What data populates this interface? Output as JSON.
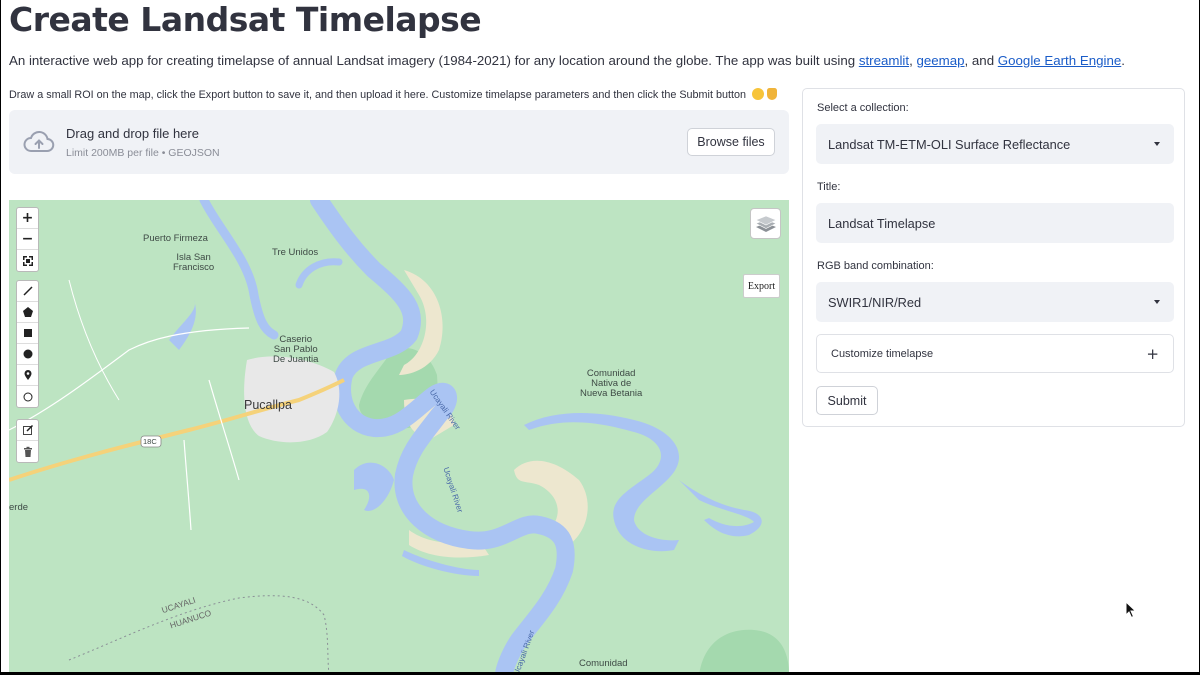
{
  "header": {
    "title": "Create Landsat Timelapse",
    "intro_prefix": "An interactive web app for creating timelapse of annual Landsat imagery (1984-2021) for any location around the globe. The app was built using ",
    "link_streamlit": "streamlit",
    "sep1": ", ",
    "link_geemap": "geemap",
    "sep2": ", and ",
    "link_gee": "Google Earth Engine",
    "intro_suffix": "."
  },
  "instructions": "Draw a small ROI on the map, click the Export button to save it, and then upload it here. Customize timelapse parameters and then click the Submit button",
  "uploader": {
    "title": "Drag and drop file here",
    "limit": "Limit 200MB per file • GEOJSON",
    "browse_label": "Browse files"
  },
  "map": {
    "export_label": "Export",
    "labels": {
      "puerto_firmeza": "Puerto Firmeza",
      "isla_san_francisco": "Isla San\nFrancisco",
      "tre_unidos": "Tre Unidos",
      "caserio": "Caserio\nSan Pablo\nDe Juantia",
      "pucallpa": "Pucallpa",
      "comunidad_nativa": "Comunidad\nNativa de\nNueva Betania",
      "ucayali_river_1": "Ucayali River",
      "ucayali_river_2": "Ucayali River",
      "ucayali_river_3": "Ucayali River",
      "road_18c": "18C",
      "verde": "erde",
      "ucayali_region": "UCAYALI",
      "huanuco_region": "HUANUCO",
      "comunidad_bottom": "Comunidad"
    },
    "colors": {
      "land": "#bde4c2",
      "water": "#aac4f3",
      "sand": "#ede7cf",
      "urban": "#e8e8e8",
      "road": "#f5d27a"
    }
  },
  "panel": {
    "collection_label": "Select a collection:",
    "collection_value": "Landsat TM-ETM-OLI Surface Reflectance",
    "title_label": "Title:",
    "title_value": "Landsat Timelapse",
    "rgb_label": "RGB band combination:",
    "rgb_value": "SWIR1/NIR/Red",
    "customize_label": "Customize timelapse",
    "submit_label": "Submit"
  }
}
